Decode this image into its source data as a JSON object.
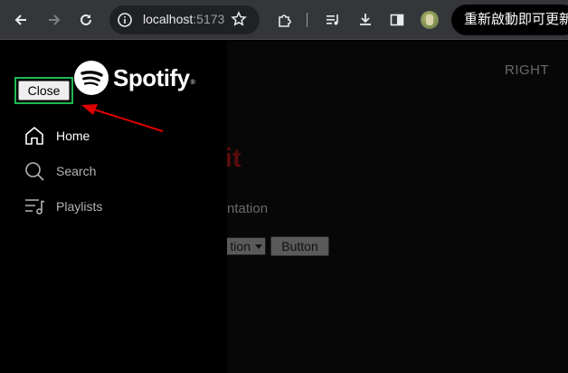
{
  "browser": {
    "url_host": "localhost",
    "url_port": ":5173",
    "update_label": "重新啟動即可更新"
  },
  "page": {
    "right_label": "RIGHT",
    "heading_visible": "elteKit",
    "link_visible": "ocumentation",
    "select_visible": "tion",
    "button_label": "Button"
  },
  "sidebar": {
    "close_label": "Close",
    "logo_text": "Spotify",
    "items": [
      {
        "label": "Home",
        "icon": "home-icon",
        "active": true
      },
      {
        "label": "Search",
        "icon": "search-icon",
        "active": false
      },
      {
        "label": "Playlists",
        "icon": "playlists-icon",
        "active": false
      }
    ]
  },
  "colors": {
    "brand_green": "#1db954",
    "annotation_red": "#e00000",
    "active_text": "#ffffff",
    "inactive_text": "#b3b3b3"
  }
}
